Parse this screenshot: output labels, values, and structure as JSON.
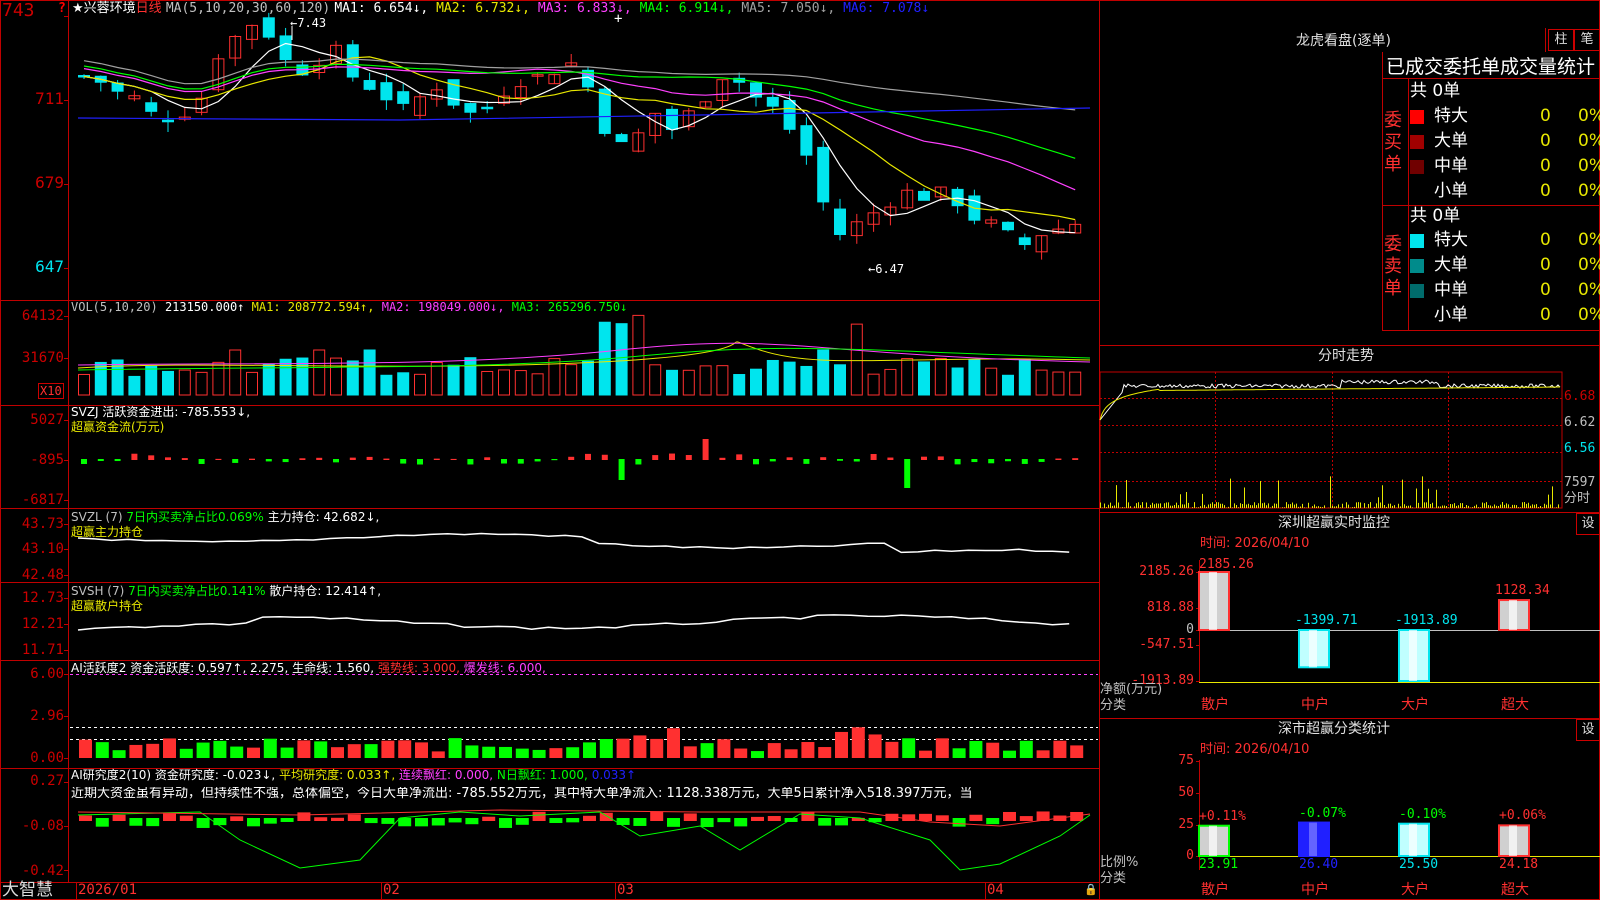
{
  "colors": {
    "up": "#ff3030",
    "down": "#00e5ee",
    "panel_border": "#c00000",
    "ma1": "#ffffff",
    "ma2": "#e8e800",
    "ma3": "#ff40ff",
    "ma4": "#00ff00",
    "ma5": "#a0a0a0",
    "ma6": "#2020ff",
    "green": "#00ff00",
    "magenta": "#ff40ff"
  },
  "header": {
    "star": "★",
    "stock_name": "兴蓉环境",
    "period": "日线",
    "ma_label": "MA(5,10,20,30,60,120)",
    "ma_values": [
      {
        "text": "MA1: 6.654↓,",
        "color": "ma1"
      },
      {
        "text": "MA2: 6.732↓,",
        "color": "ma2"
      },
      {
        "text": "MA3: 6.833↓,",
        "color": "ma3"
      },
      {
        "text": "MA4: 6.914↓,",
        "color": "ma4"
      },
      {
        "text": "MA5: 7.050↓,",
        "color": "ma5"
      },
      {
        "text": "MA6: 7.078↓",
        "color": "ma6"
      }
    ],
    "high_mark": "7.43",
    "low_mark": "6.47",
    "question_mark": "?",
    "plus_mark": "+"
  },
  "price_axis": [
    "743",
    "711",
    "679",
    "647"
  ],
  "vol": {
    "title": "VOL(5,10,20)",
    "value": "213150.000↑",
    "ma1": "MA1: 208772.594↑,",
    "ma2": "MA2: 198049.000↓,",
    "ma3": "MA3: 265296.750↓",
    "axis": [
      "64132",
      "31670"
    ],
    "unit": "X10"
  },
  "svzj": {
    "title": "SVZJ  活跃资金进出: -785.553↓,",
    "sub": "超赢资金流(万元)",
    "axis": [
      "5027",
      "-895",
      "-6817"
    ]
  },
  "svzl": {
    "title": "SVZL (7)",
    "ratio": "7日内买卖净占比0.069%",
    "hold": "主力持仓: 42.682↓,",
    "sub": "超赢主力持仓",
    "axis": [
      "43.73",
      "43.10",
      "42.48"
    ]
  },
  "svsh": {
    "title": "SVSH (7)",
    "ratio": "7日内买卖净占比0.141%",
    "hold": "散户持仓: 12.414↑,",
    "sub": "超赢散户持仓",
    "axis": [
      "12.73",
      "12.21",
      "11.71"
    ]
  },
  "ai1": {
    "title": "AI活跃度2 资金活跃度: 0.597↑, 2.275, 生命线: 1.560,",
    "strong": "强势线: 3.000,",
    "burst": "爆发线: 6.000,",
    "axis": [
      "6.00",
      "2.96",
      "0.00"
    ]
  },
  "ai2": {
    "title": "AI研究度2(10) 资金研究度: -0.023↓,",
    "avg": "平均研究度: 0.033↑,",
    "red": "连续飘红: 0.000,",
    "nred": "N日飘红: 1.000,",
    "last": "0.033↑",
    "note": "近期大资金虽有异动，但持续性不强，总体偏空，今日大单净流出: -785.552万元，其中特大单净流入: 1128.338万元，大单5日累计净入518.397万元，当",
    "axis": [
      "0.27",
      "-0.08",
      "-0.42"
    ]
  },
  "date_axis": [
    "2026/01",
    "02",
    "03",
    "04"
  ],
  "brand": "大智慧",
  "right": {
    "dragon_title": "龙虎看盘(逐单)",
    "btn_zhu": "柱",
    "btn_bi": "笔",
    "tabs_text": "已成交委托单成交量统计",
    "buy_label": "委买单",
    "sell_label": "委卖单",
    "buy_total": "共 0单",
    "sell_total": "共 0单",
    "buy_rows": [
      {
        "name": "特大",
        "count": "0",
        "pct": "0%",
        "color": "#ff0000"
      },
      {
        "name": "大单",
        "count": "0",
        "pct": "0%",
        "color": "#a00000"
      },
      {
        "name": "中单",
        "count": "0",
        "pct": "0%",
        "color": "#700000"
      },
      {
        "name": "小单",
        "count": "0",
        "pct": "0%",
        "color": "#000000"
      }
    ],
    "sell_rows": [
      {
        "name": "特大",
        "count": "0",
        "pct": "0%",
        "color": "#00e5ee"
      },
      {
        "name": "大单",
        "count": "0",
        "pct": "0%",
        "color": "#008b8b"
      },
      {
        "name": "中单",
        "count": "0",
        "pct": "0%",
        "color": "#006b6b"
      },
      {
        "name": "小单",
        "count": "0",
        "pct": "0%",
        "color": "#000000"
      }
    ],
    "intraday_title": "分时走势",
    "intraday_axis": [
      "6.68",
      "6.62",
      "6.56",
      "7597",
      "分时"
    ],
    "monitor_title": "深圳超赢实时监控",
    "settings_label": "设",
    "monitor_time": "时间: 2026/04/10",
    "monitor_axis": [
      "2185.26",
      "818.88",
      "0",
      "-547.51",
      "-1913.89"
    ],
    "monitor_axis_title": "净额(万元)",
    "monitor_category_title": "分类",
    "monitor_chart": {
      "type": "bar",
      "categories": [
        "散户",
        "中户",
        "大户",
        "超大"
      ],
      "values": [
        2185.26,
        -1399.71,
        -1913.89,
        1128.34
      ],
      "labels": [
        "2185.26",
        "-1399.71",
        "-1913.89",
        "1128.34"
      ]
    },
    "stat_title": "深市超赢分类统计",
    "stat_time": "时间: 2026/04/10",
    "stat_axis": [
      "75",
      "50",
      "25",
      "0"
    ],
    "stat_axis_title": "比例%",
    "stat_category_title": "分类",
    "stat_chart": {
      "type": "bar",
      "categories": [
        "散户",
        "中户",
        "大户",
        "超大"
      ],
      "values": [
        23.91,
        26.4,
        25.5,
        24.18
      ],
      "changes": [
        "+0.11%",
        "-0.07%",
        "-0.10%",
        "+0.06%"
      ],
      "value_labels": [
        "23.91",
        "26.40",
        "25.50",
        "24.18"
      ]
    }
  }
}
